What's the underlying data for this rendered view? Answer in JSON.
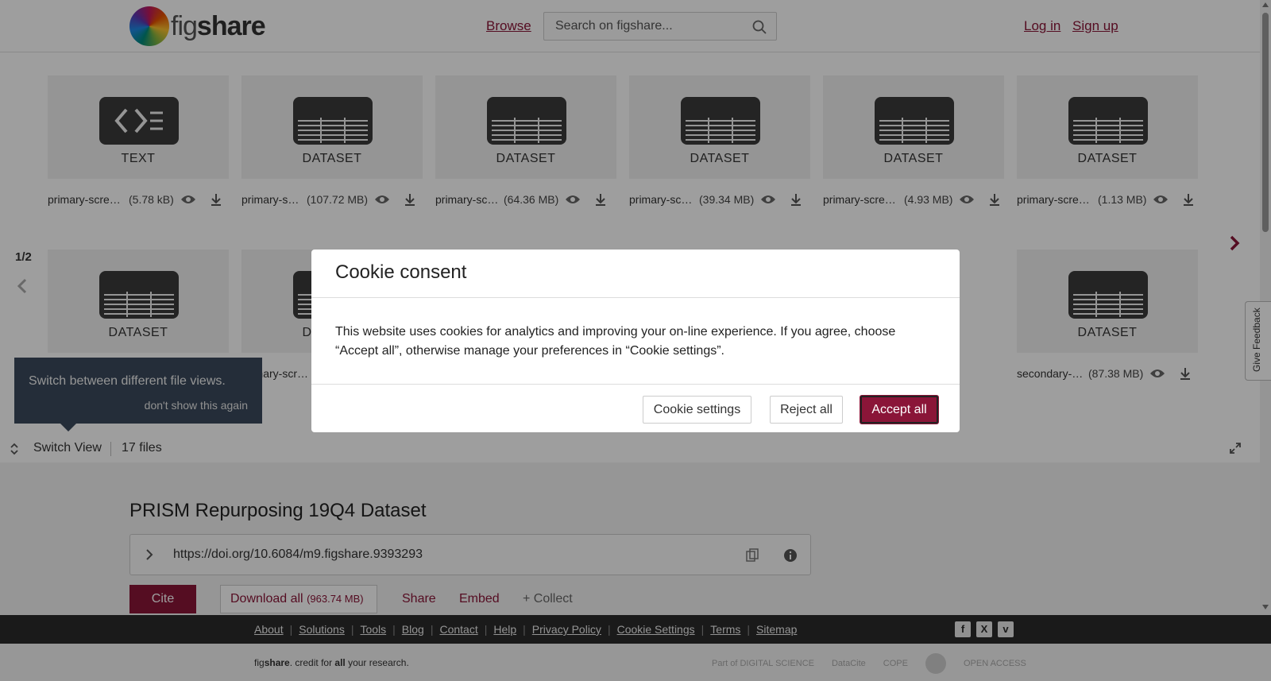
{
  "header": {
    "logo_prefix": "fig",
    "logo_suffix": "share",
    "browse_label": "Browse",
    "search_placeholder": "Search on figshare...",
    "login_label": "Log in",
    "signup_label": "Sign up"
  },
  "files": {
    "row1": [
      {
        "type": "TEXT",
        "name": "primary-screen-readme.txt",
        "size": "(5.78 kB)"
      },
      {
        "type": "DATASET",
        "name": "primary-screen-logfold-change.csv",
        "size": "(107.72 MB)"
      },
      {
        "type": "DATASET",
        "name": "primary-screen-replicate-logfold.csv",
        "size": "(64.36 MB)"
      },
      {
        "type": "DATASET",
        "name": "primary-screen-cell-line-info.csv",
        "size": "(39.34 MB)"
      },
      {
        "type": "DATASET",
        "name": "primary-screen-pooling-info.csv",
        "size": "(4.93 MB)"
      },
      {
        "type": "DATASET",
        "name": "primary-screen-compound-list.csv",
        "size": "(1.13 MB)"
      }
    ],
    "row2": [
      {
        "type": "DATASET"
      },
      {
        "type": "DATASET",
        "name": "primary-screen-replicate-collapsed.csv"
      },
      {
        "type": "DATASET",
        "name": "secondary-screen-dose-response.csv",
        "size": "(87.38 MB)"
      }
    ],
    "pager": "1/2"
  },
  "tooltip": {
    "text": "Switch between different file views.",
    "dismiss": "don't show this again"
  },
  "switchbar": {
    "label": "Switch View",
    "count": "17 files"
  },
  "item": {
    "title": "PRISM Repurposing 19Q4 Dataset",
    "doi": "https://doi.org/10.6084/m9.figshare.9393293",
    "cite_label": "Cite",
    "download_label": "Download all",
    "download_size": "(963.74 MB)",
    "share_label": "Share",
    "embed_label": "Embed",
    "collect_label": "+ Collect"
  },
  "footer": {
    "links": [
      "About",
      "Solutions",
      "Tools",
      "Blog",
      "Contact",
      "Help",
      "Privacy Policy",
      "Cookie Settings",
      "Terms",
      "Sitemap"
    ],
    "tagline_pre": "fig",
    "tagline_bold1": "share",
    "tagline_mid": ". credit for ",
    "tagline_bold2": "all",
    "tagline_post": " your research.",
    "partner_digital_science": "Part of DIGITAL SCIENCE",
    "partner_datacite": "DataCite",
    "partner_cope": "COPE",
    "partner_open_access": "OPEN ACCESS"
  },
  "feedback_label": "Give Feedback",
  "cookie_modal": {
    "title": "Cookie consent",
    "body": "This website uses cookies for analytics and improving your on-line experience. If you agree, choose “Accept all”, otherwise manage your preferences in “Cookie settings”.",
    "settings_label": "Cookie settings",
    "reject_label": "Reject all",
    "accept_label": "Accept all"
  },
  "colors": {
    "brand": "#8a1538",
    "overlay": "rgba(0,0,0,0.38)",
    "footer_bg": "#2b2b2b"
  }
}
